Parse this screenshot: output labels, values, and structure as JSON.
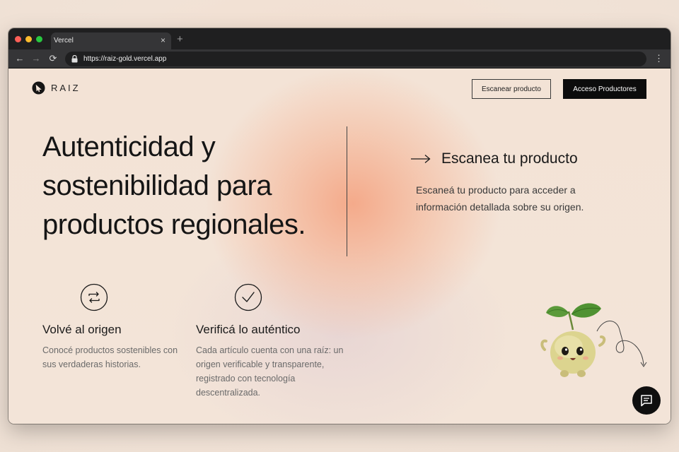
{
  "browser": {
    "tab_title": "Vercel",
    "tab_close": "×",
    "new_tab": "+",
    "url": "https://raiz-gold.vercel.app",
    "back": "←",
    "forward": "→",
    "reload": "⟳",
    "menu": "⋮"
  },
  "header": {
    "logo_text": "RAIZ",
    "scan_button": "Escanear producto",
    "producers_button": "Acceso Productores"
  },
  "hero": {
    "line1": "Autenticidad y",
    "line2": "sostenibilidad para",
    "line3": "productos regionales."
  },
  "scan": {
    "title": "Escanea tu producto",
    "description": "Escaneá tu producto para acceder a información detallada sobre su origen."
  },
  "features": [
    {
      "icon": "cycle-icon",
      "title": "Volvé al origen",
      "description": "Conocé productos sostenibles con sus verdaderas historias."
    },
    {
      "icon": "check-circle-icon",
      "title": "Verificá lo auténtico",
      "description": "Cada artículo cuenta con una raíz: un origen verificable y transparente, registrado con tecnología descentralizada."
    }
  ],
  "chat": {
    "icon": "chat-icon"
  },
  "colors": {
    "accent_glow": "#f4a07d",
    "text_dark": "#151515",
    "button_dark": "#0c0c0c"
  }
}
